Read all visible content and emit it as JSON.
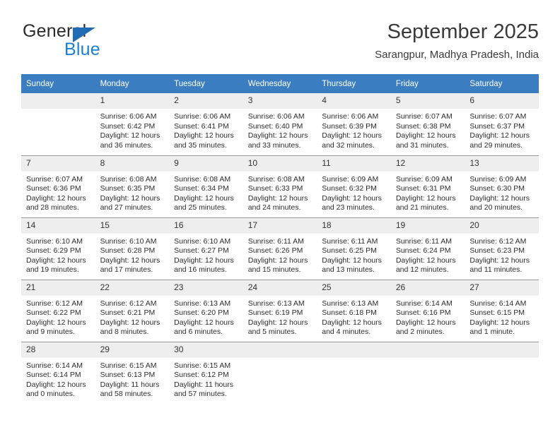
{
  "brand": {
    "name_top": "General",
    "name_bottom": "Blue",
    "triangle_color": "#1f6cb4",
    "blue_text_color": "#1b7fd4"
  },
  "header": {
    "title": "September 2025",
    "subtitle": "Sarangpur, Madhya Pradesh, India"
  },
  "theme": {
    "header_row_bg": "#3a7dc0",
    "header_row_text": "#ffffff",
    "daynum_bg": "#eeeeee",
    "grid_line": "#9a9a9a"
  },
  "columns": [
    "Sunday",
    "Monday",
    "Tuesday",
    "Wednesday",
    "Thursday",
    "Friday",
    "Saturday"
  ],
  "weeks": [
    [
      {
        "day": "",
        "empty": true,
        "sunrise": "",
        "sunset": "",
        "daylight_line1": "",
        "daylight_line2": ""
      },
      {
        "day": "1",
        "sunrise": "Sunrise: 6:06 AM",
        "sunset": "Sunset: 6:42 PM",
        "daylight_line1": "Daylight: 12 hours",
        "daylight_line2": "and 36 minutes."
      },
      {
        "day": "2",
        "sunrise": "Sunrise: 6:06 AM",
        "sunset": "Sunset: 6:41 PM",
        "daylight_line1": "Daylight: 12 hours",
        "daylight_line2": "and 35 minutes."
      },
      {
        "day": "3",
        "sunrise": "Sunrise: 6:06 AM",
        "sunset": "Sunset: 6:40 PM",
        "daylight_line1": "Daylight: 12 hours",
        "daylight_line2": "and 33 minutes."
      },
      {
        "day": "4",
        "sunrise": "Sunrise: 6:06 AM",
        "sunset": "Sunset: 6:39 PM",
        "daylight_line1": "Daylight: 12 hours",
        "daylight_line2": "and 32 minutes."
      },
      {
        "day": "5",
        "sunrise": "Sunrise: 6:07 AM",
        "sunset": "Sunset: 6:38 PM",
        "daylight_line1": "Daylight: 12 hours",
        "daylight_line2": "and 31 minutes."
      },
      {
        "day": "6",
        "sunrise": "Sunrise: 6:07 AM",
        "sunset": "Sunset: 6:37 PM",
        "daylight_line1": "Daylight: 12 hours",
        "daylight_line2": "and 29 minutes."
      }
    ],
    [
      {
        "day": "7",
        "sunrise": "Sunrise: 6:07 AM",
        "sunset": "Sunset: 6:36 PM",
        "daylight_line1": "Daylight: 12 hours",
        "daylight_line2": "and 28 minutes."
      },
      {
        "day": "8",
        "sunrise": "Sunrise: 6:08 AM",
        "sunset": "Sunset: 6:35 PM",
        "daylight_line1": "Daylight: 12 hours",
        "daylight_line2": "and 27 minutes."
      },
      {
        "day": "9",
        "sunrise": "Sunrise: 6:08 AM",
        "sunset": "Sunset: 6:34 PM",
        "daylight_line1": "Daylight: 12 hours",
        "daylight_line2": "and 25 minutes."
      },
      {
        "day": "10",
        "sunrise": "Sunrise: 6:08 AM",
        "sunset": "Sunset: 6:33 PM",
        "daylight_line1": "Daylight: 12 hours",
        "daylight_line2": "and 24 minutes."
      },
      {
        "day": "11",
        "sunrise": "Sunrise: 6:09 AM",
        "sunset": "Sunset: 6:32 PM",
        "daylight_line1": "Daylight: 12 hours",
        "daylight_line2": "and 23 minutes."
      },
      {
        "day": "12",
        "sunrise": "Sunrise: 6:09 AM",
        "sunset": "Sunset: 6:31 PM",
        "daylight_line1": "Daylight: 12 hours",
        "daylight_line2": "and 21 minutes."
      },
      {
        "day": "13",
        "sunrise": "Sunrise: 6:09 AM",
        "sunset": "Sunset: 6:30 PM",
        "daylight_line1": "Daylight: 12 hours",
        "daylight_line2": "and 20 minutes."
      }
    ],
    [
      {
        "day": "14",
        "sunrise": "Sunrise: 6:10 AM",
        "sunset": "Sunset: 6:29 PM",
        "daylight_line1": "Daylight: 12 hours",
        "daylight_line2": "and 19 minutes."
      },
      {
        "day": "15",
        "sunrise": "Sunrise: 6:10 AM",
        "sunset": "Sunset: 6:28 PM",
        "daylight_line1": "Daylight: 12 hours",
        "daylight_line2": "and 17 minutes."
      },
      {
        "day": "16",
        "sunrise": "Sunrise: 6:10 AM",
        "sunset": "Sunset: 6:27 PM",
        "daylight_line1": "Daylight: 12 hours",
        "daylight_line2": "and 16 minutes."
      },
      {
        "day": "17",
        "sunrise": "Sunrise: 6:11 AM",
        "sunset": "Sunset: 6:26 PM",
        "daylight_line1": "Daylight: 12 hours",
        "daylight_line2": "and 15 minutes."
      },
      {
        "day": "18",
        "sunrise": "Sunrise: 6:11 AM",
        "sunset": "Sunset: 6:25 PM",
        "daylight_line1": "Daylight: 12 hours",
        "daylight_line2": "and 13 minutes."
      },
      {
        "day": "19",
        "sunrise": "Sunrise: 6:11 AM",
        "sunset": "Sunset: 6:24 PM",
        "daylight_line1": "Daylight: 12 hours",
        "daylight_line2": "and 12 minutes."
      },
      {
        "day": "20",
        "sunrise": "Sunrise: 6:12 AM",
        "sunset": "Sunset: 6:23 PM",
        "daylight_line1": "Daylight: 12 hours",
        "daylight_line2": "and 11 minutes."
      }
    ],
    [
      {
        "day": "21",
        "sunrise": "Sunrise: 6:12 AM",
        "sunset": "Sunset: 6:22 PM",
        "daylight_line1": "Daylight: 12 hours",
        "daylight_line2": "and 9 minutes."
      },
      {
        "day": "22",
        "sunrise": "Sunrise: 6:12 AM",
        "sunset": "Sunset: 6:21 PM",
        "daylight_line1": "Daylight: 12 hours",
        "daylight_line2": "and 8 minutes."
      },
      {
        "day": "23",
        "sunrise": "Sunrise: 6:13 AM",
        "sunset": "Sunset: 6:20 PM",
        "daylight_line1": "Daylight: 12 hours",
        "daylight_line2": "and 6 minutes."
      },
      {
        "day": "24",
        "sunrise": "Sunrise: 6:13 AM",
        "sunset": "Sunset: 6:19 PM",
        "daylight_line1": "Daylight: 12 hours",
        "daylight_line2": "and 5 minutes."
      },
      {
        "day": "25",
        "sunrise": "Sunrise: 6:13 AM",
        "sunset": "Sunset: 6:18 PM",
        "daylight_line1": "Daylight: 12 hours",
        "daylight_line2": "and 4 minutes."
      },
      {
        "day": "26",
        "sunrise": "Sunrise: 6:14 AM",
        "sunset": "Sunset: 6:16 PM",
        "daylight_line1": "Daylight: 12 hours",
        "daylight_line2": "and 2 minutes."
      },
      {
        "day": "27",
        "sunrise": "Sunrise: 6:14 AM",
        "sunset": "Sunset: 6:15 PM",
        "daylight_line1": "Daylight: 12 hours",
        "daylight_line2": "and 1 minute."
      }
    ],
    [
      {
        "day": "28",
        "sunrise": "Sunrise: 6:14 AM",
        "sunset": "Sunset: 6:14 PM",
        "daylight_line1": "Daylight: 12 hours",
        "daylight_line2": "and 0 minutes."
      },
      {
        "day": "29",
        "sunrise": "Sunrise: 6:15 AM",
        "sunset": "Sunset: 6:13 PM",
        "daylight_line1": "Daylight: 11 hours",
        "daylight_line2": "and 58 minutes."
      },
      {
        "day": "30",
        "sunrise": "Sunrise: 6:15 AM",
        "sunset": "Sunset: 6:12 PM",
        "daylight_line1": "Daylight: 11 hours",
        "daylight_line2": "and 57 minutes."
      },
      {
        "day": "",
        "empty": true,
        "sunrise": "",
        "sunset": "",
        "daylight_line1": "",
        "daylight_line2": ""
      },
      {
        "day": "",
        "empty": true,
        "sunrise": "",
        "sunset": "",
        "daylight_line1": "",
        "daylight_line2": ""
      },
      {
        "day": "",
        "empty": true,
        "sunrise": "",
        "sunset": "",
        "daylight_line1": "",
        "daylight_line2": ""
      },
      {
        "day": "",
        "empty": true,
        "sunrise": "",
        "sunset": "",
        "daylight_line1": "",
        "daylight_line2": ""
      }
    ]
  ]
}
